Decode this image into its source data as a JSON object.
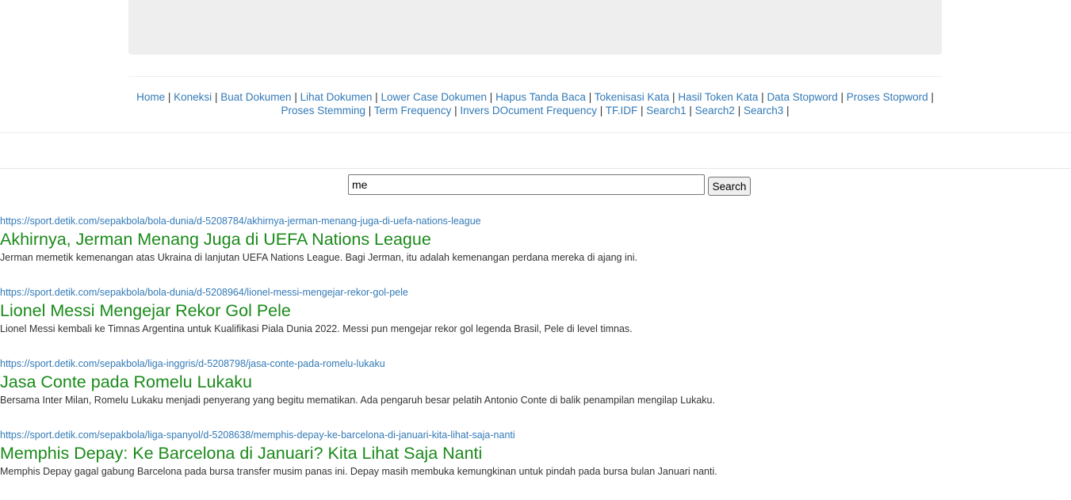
{
  "nav": {
    "links": [
      "Home",
      "Koneksi",
      "Buat Dokumen",
      "Lihat Dokumen",
      "Lower Case Dokumen",
      "Hapus Tanda Baca",
      "Tokenisasi Kata",
      "Hasil Token Kata",
      "Data Stopword",
      "Proses Stopword",
      "Proses Stemming",
      "Term Frequency",
      "Invers DOcument Frequency",
      "TF.IDF",
      "Search1",
      "Search2",
      "Search3"
    ],
    "separator": "|"
  },
  "search": {
    "value": "me",
    "button_label": "Search"
  },
  "results": [
    {
      "url": "https://sport.detik.com/sepakbola/bola-dunia/d-5208784/akhirnya-jerman-menang-juga-di-uefa-nations-league",
      "title": "Akhirnya, Jerman Menang Juga di UEFA Nations League",
      "snippet": "Jerman memetik kemenangan atas Ukraina di lanjutan UEFA Nations League. Bagi Jerman, itu adalah kemenangan perdana mereka di ajang ini."
    },
    {
      "url": "https://sport.detik.com/sepakbola/bola-dunia/d-5208964/lionel-messi-mengejar-rekor-gol-pele",
      "title": "Lionel Messi Mengejar Rekor Gol Pele",
      "snippet": "Lionel Messi kembali ke Timnas Argentina untuk Kualifikasi Piala Dunia 2022. Messi pun mengejar rekor gol legenda Brasil, Pele di level timnas."
    },
    {
      "url": "https://sport.detik.com/sepakbola/liga-inggris/d-5208798/jasa-conte-pada-romelu-lukaku",
      "title": "Jasa Conte pada Romelu Lukaku",
      "snippet": "Bersama Inter Milan, Romelu Lukaku menjadi penyerang yang begitu mematikan. Ada pengaruh besar pelatih Antonio Conte di balik penampilan mengilap Lukaku."
    },
    {
      "url": "https://sport.detik.com/sepakbola/liga-spanyol/d-5208638/memphis-depay-ke-barcelona-di-januari-kita-lihat-saja-nanti",
      "title": "Memphis Depay: Ke Barcelona di Januari? Kita Lihat Saja Nanti",
      "snippet": "Memphis Depay gagal gabung Barcelona pada bursa transfer musim panas ini. Depay masih membuka kemungkinan untuk pindah pada bursa bulan Januari nanti."
    }
  ]
}
